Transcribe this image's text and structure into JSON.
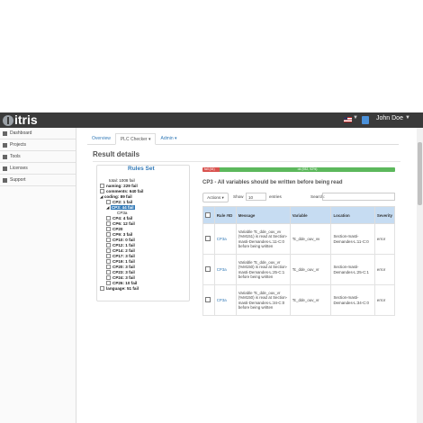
{
  "app": {
    "logo": "itris"
  },
  "header": {
    "user": "John Doe"
  },
  "sidebar": {
    "items": [
      {
        "label": "Dashboard",
        "icon": "dashboard-icon"
      },
      {
        "label": "Projects",
        "icon": "projects-icon"
      },
      {
        "label": "Tools",
        "icon": "tools-icon"
      },
      {
        "label": "Licenses",
        "icon": "licenses-icon"
      },
      {
        "label": "Support",
        "icon": "support-icon"
      }
    ]
  },
  "tabs": [
    {
      "label": "Overview"
    },
    {
      "label": "PLC Checker ▾"
    },
    {
      "label": "Admin ▾"
    }
  ],
  "page_title": "Result details",
  "rules": {
    "title": "Rules Set",
    "tree": [
      {
        "text": "total: 1008 fail"
      },
      {
        "text": "naming: 229 fail"
      },
      {
        "text": "comments: 640 fail"
      },
      {
        "text": "coding: 89 fail"
      },
      {
        "text": "CP2: 1 fail"
      },
      {
        "text": "CP3: 44 fail"
      },
      {
        "text": "CP3a"
      },
      {
        "text": "CP4: 4 fail"
      },
      {
        "text": "CP6: 12 fail"
      },
      {
        "text": "CP20"
      },
      {
        "text": "CP9: 3 fail"
      },
      {
        "text": "CP10: 0 fail"
      },
      {
        "text": "CP12: 1 fail"
      },
      {
        "text": "CP14: 2 fail"
      },
      {
        "text": "CP17: 3 fail"
      },
      {
        "text": "CP19: 1 fail"
      },
      {
        "text": "CP20: 3 fail"
      },
      {
        "text": "CP23: 3 fail"
      },
      {
        "text": "CP24: 3 fail"
      },
      {
        "text": "CP26: 10 fail"
      },
      {
        "text": "language: 51 fail"
      }
    ]
  },
  "progress": {
    "fail_label": "fail (44)",
    "ok_label": "ok (932, 92%)",
    "ok_fraction": 0.92,
    "fail_color": "#d9534f",
    "ok_color": "#5cb85c"
  },
  "rule_heading": "CP3 - All variables should be written before being read",
  "controls": {
    "actions": "Actions ▾",
    "show": "Show",
    "page_size": "10",
    "entries": "entries",
    "search": "Search:"
  },
  "table": {
    "headers": [
      "",
      "Rule #ID",
      "Message",
      "Variable",
      "Location",
      "Severity"
    ],
    "rows": [
      {
        "id": "CP3a",
        "message": "Variable Tc_dde_ouv_vv (%M151) is read at Section-masti-Demandes-L:11-C:0 before being written",
        "variable": "Tc_dde_ouv_vv",
        "location": "Section-masti-Demandes-L:11-C:0",
        "severity": "error"
      },
      {
        "id": "CP3a",
        "message": "Variable Tc_dde_ouv_vr (%M150) is read at Section-masti-Demandes-L:25-C:1 before being written",
        "variable": "Tc_dde_ouv_vr",
        "location": "Section-masti-Demandes-L:25-C:1",
        "severity": "error"
      },
      {
        "id": "CP3a",
        "message": "Variable Tc_dde_ouv_vr (%M150) is read at Section-masti-Demandes-L:34-C:0 before being written",
        "variable": "Tc_dde_ouv_vr",
        "location": "Section-masti-Demandes-L:34-C:0",
        "severity": "error"
      }
    ]
  }
}
